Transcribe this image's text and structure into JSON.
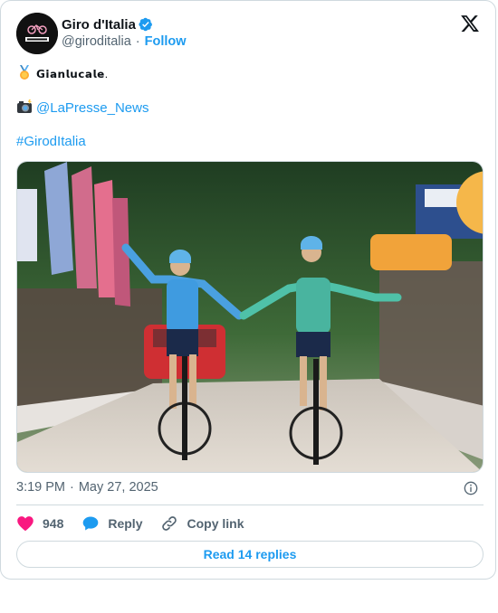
{
  "author": {
    "name": "Giro d'Italia",
    "handle": "@giroditalia",
    "follow_label": "Follow",
    "separator": "·",
    "avatar_text": "Giro d'Italia"
  },
  "tweet": {
    "medal_text": "𝗚𝗶𝗮𝗻𝗹𝘂𝗰𝗮𝗹𝗲.",
    "credit_link": "@LaPresse_News",
    "hashtag": "#GirodItalia"
  },
  "meta": {
    "time": "3:19 PM",
    "separator": "·",
    "date": "May 27, 2025"
  },
  "actions": {
    "like_count": "948",
    "reply_label": "Reply",
    "copy_label": "Copy link"
  },
  "footer": {
    "read_replies_label": "Read 14 replies"
  },
  "colors": {
    "accent": "#1d9bf0",
    "like": "#f91880",
    "muted": "#536471",
    "border": "#cfd9de"
  },
  "icons": {
    "verified": "verified-badge-icon",
    "platform": "x-logo-icon",
    "medal": "medal-emoji-icon",
    "camera": "camera-flash-emoji-icon",
    "info": "info-icon",
    "like": "heart-icon",
    "reply": "speech-bubble-icon",
    "copy": "link-icon"
  }
}
